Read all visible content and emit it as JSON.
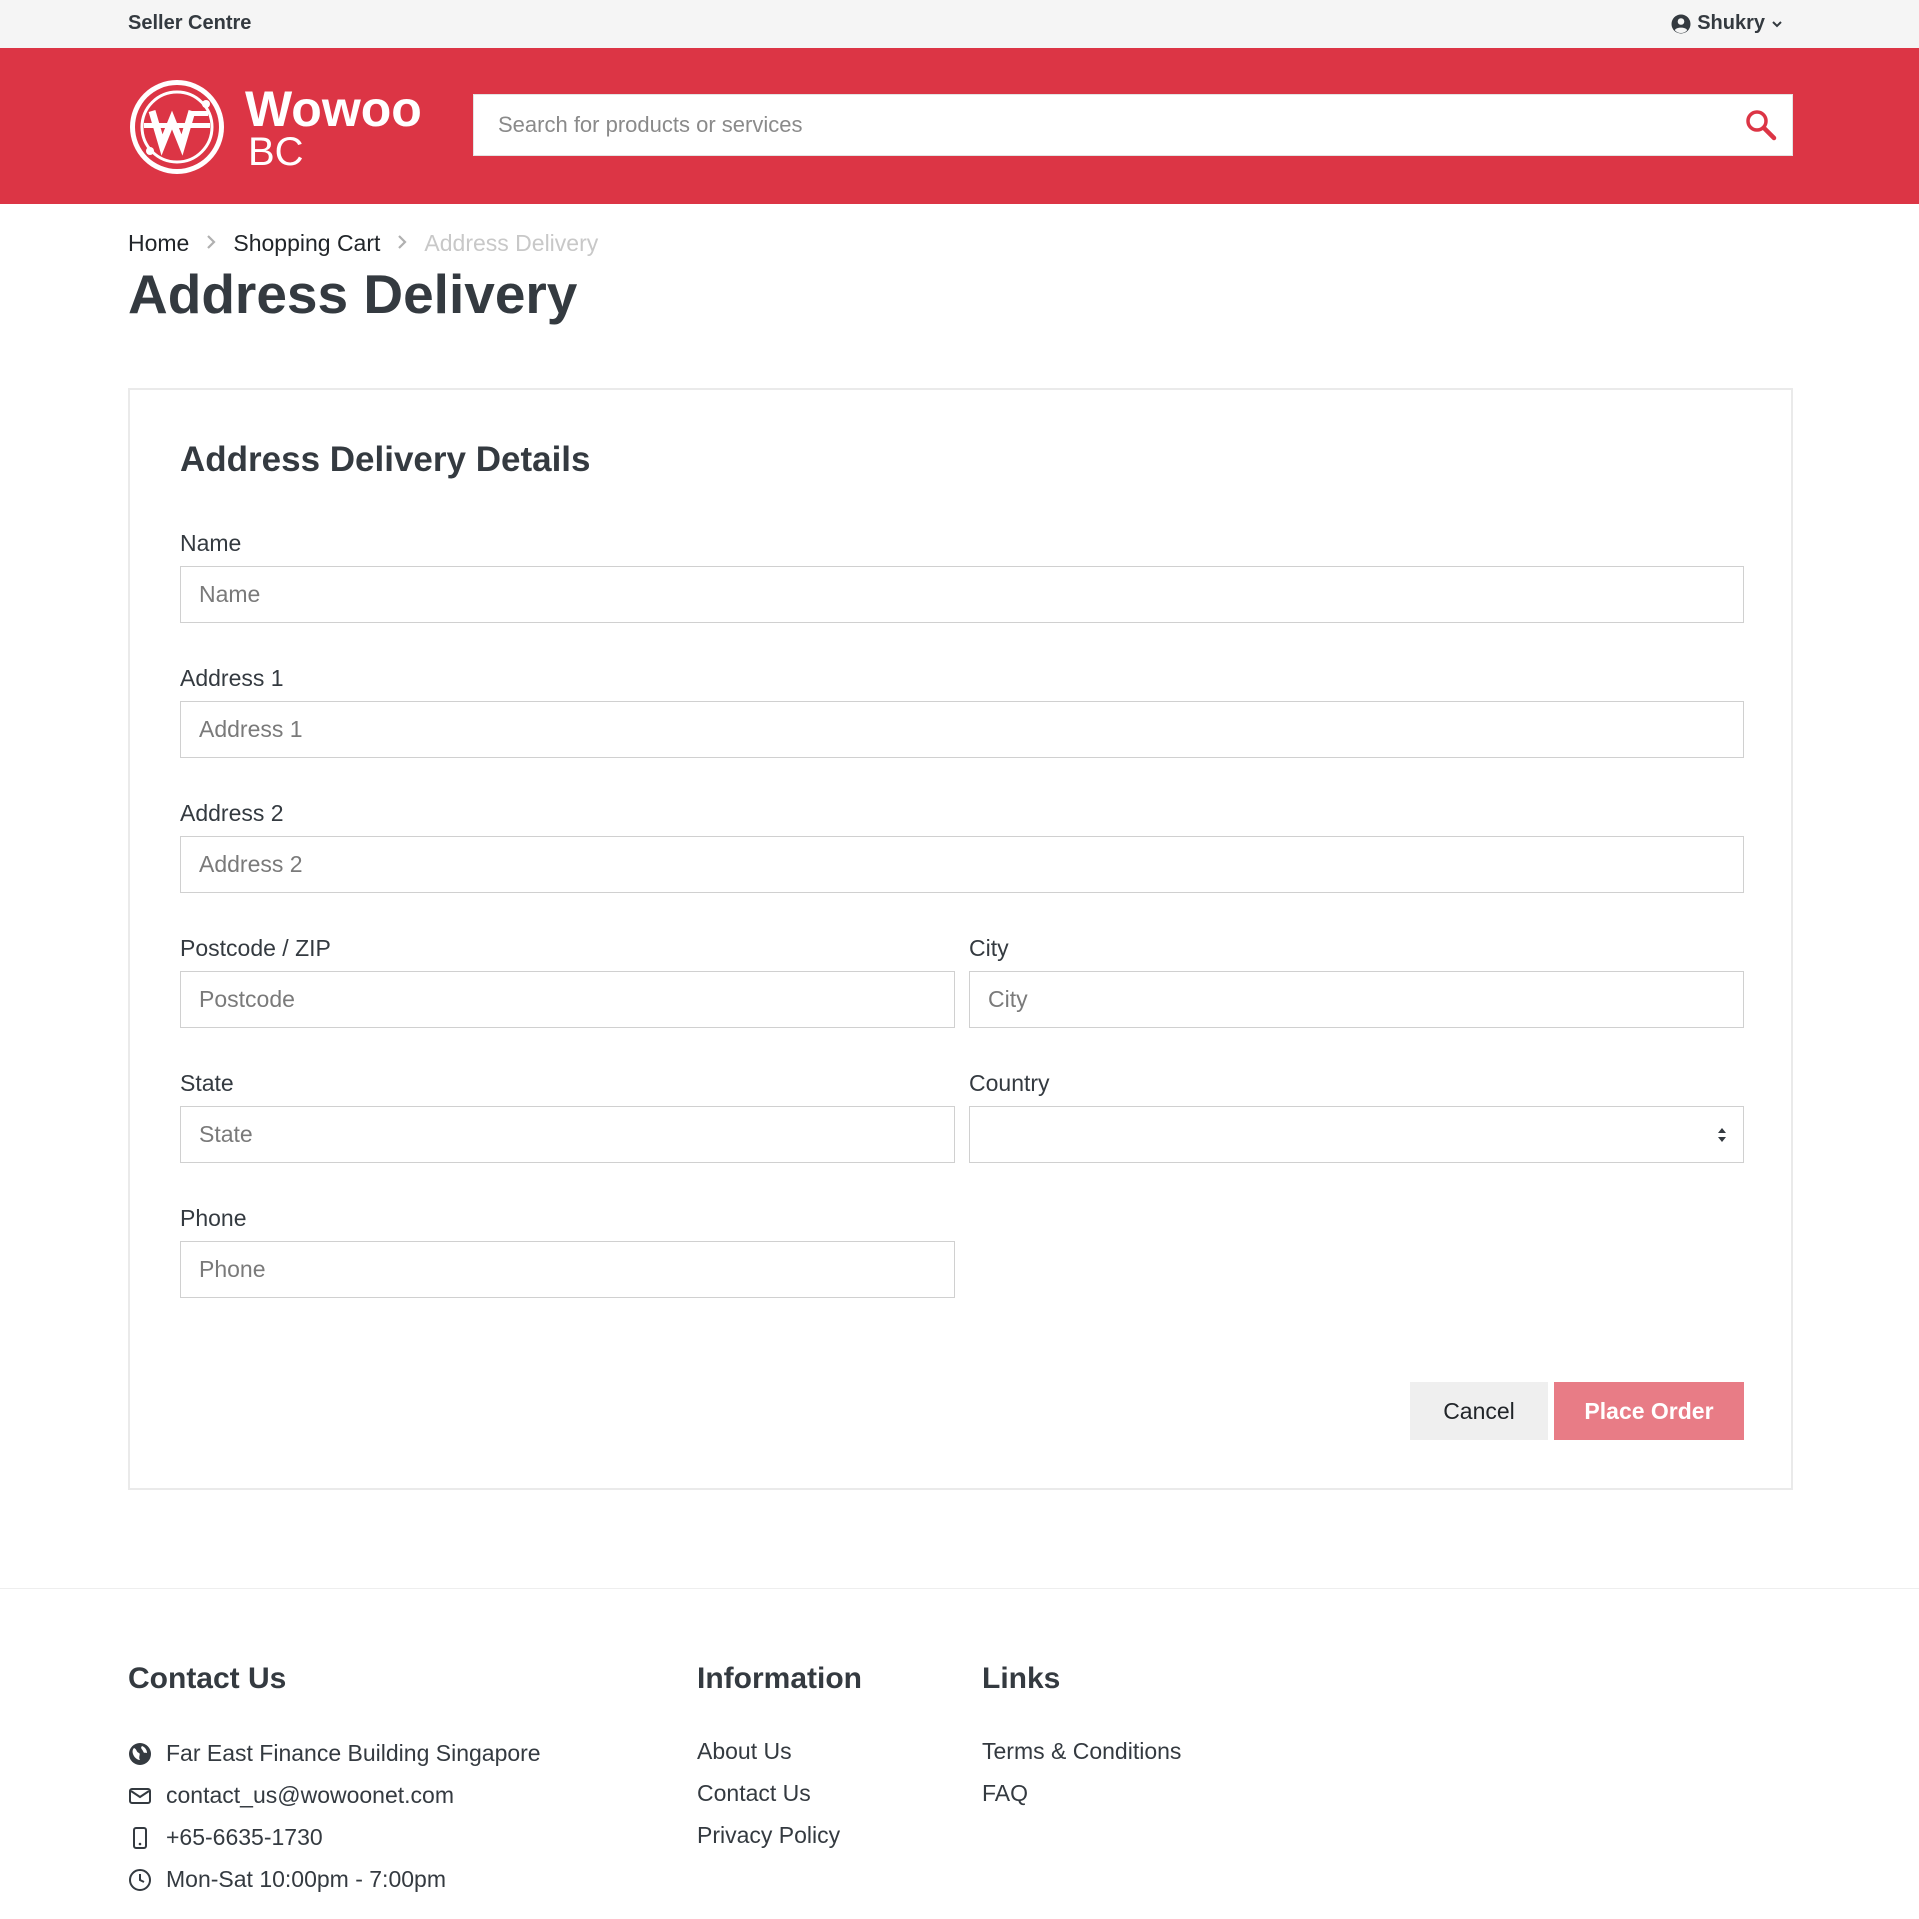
{
  "topbar": {
    "seller_centre": "Seller Centre",
    "user_name": "Shukry"
  },
  "brand": {
    "name_line1": "Wowoo",
    "name_line2": "BC",
    "accent": "#dc3545"
  },
  "search": {
    "placeholder": "Search for products or services"
  },
  "breadcrumb": {
    "home": "Home",
    "cart": "Shopping Cart",
    "current": "Address Delivery"
  },
  "page": {
    "title": "Address Delivery"
  },
  "form": {
    "title": "Address Delivery Details",
    "name": {
      "label": "Name",
      "placeholder": "Name"
    },
    "address1": {
      "label": "Address 1",
      "placeholder": "Address 1"
    },
    "address2": {
      "label": "Address 2",
      "placeholder": "Address 2"
    },
    "postcode": {
      "label": "Postcode / ZIP",
      "placeholder": "Postcode"
    },
    "city": {
      "label": "City",
      "placeholder": "City"
    },
    "state": {
      "label": "State",
      "placeholder": "State"
    },
    "country": {
      "label": "Country",
      "value": ""
    },
    "phone": {
      "label": "Phone",
      "placeholder": "Phone"
    },
    "cancel_label": "Cancel",
    "place_order_label": "Place Order"
  },
  "footer": {
    "contact": {
      "title": "Contact Us",
      "address": "Far East Finance Building Singapore",
      "email": "contact_us@wowoonet.com",
      "phone": "+65-6635-1730",
      "hours": "Mon-Sat 10:00pm - 7:00pm"
    },
    "information": {
      "title": "Information",
      "links": [
        "About Us",
        "Contact Us",
        "Privacy Policy"
      ]
    },
    "links": {
      "title": "Links",
      "items": [
        "Terms & Conditions",
        "FAQ"
      ]
    }
  }
}
